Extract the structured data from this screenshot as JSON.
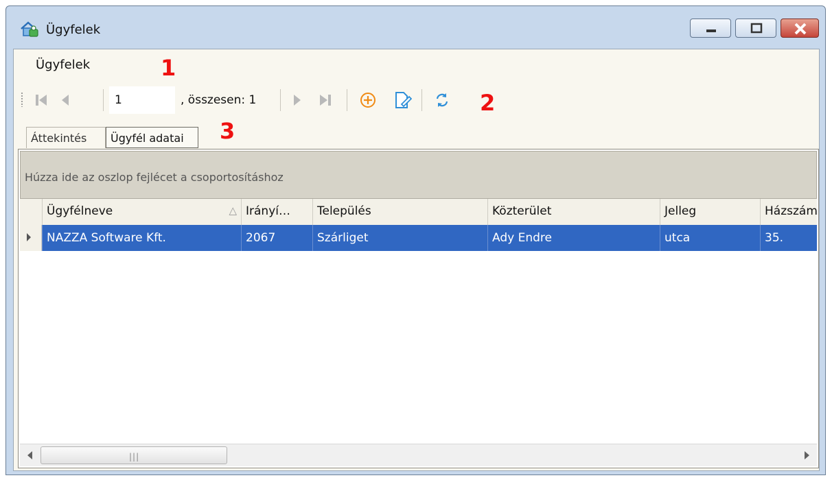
{
  "window": {
    "title": "Ügyfelek"
  },
  "menu": {
    "items": [
      "Ügyfelek"
    ]
  },
  "navigator": {
    "position": "1",
    "total_label": ", összesen: 1"
  },
  "annotations": [
    "1",
    "2",
    "3"
  ],
  "tabs": [
    "Áttekintés",
    "Ügyfél adatai"
  ],
  "grid": {
    "group_panel_text": "Húzza ide az oszlop fejlécet a csoportosításhoz",
    "columns": [
      "Ügyfélneve",
      "Irányí…",
      "Település",
      "Közterület",
      "Jelleg",
      "Házszám"
    ],
    "rows": [
      [
        "NAZZA Software Kft.",
        "2067",
        "Szárliget",
        "Ady Endre",
        "utca",
        "35."
      ]
    ],
    "sort_column": "Ügyfélneve",
    "sort_direction": "ascending"
  },
  "colors": {
    "selection": "#3067c2",
    "annotation": "#e11111",
    "accent_add": "#f08a14",
    "accent_edit": "#2f8fd8"
  },
  "icons": {
    "app": "customers-house-icon",
    "toolbar": [
      "first-record-icon",
      "previous-record-icon",
      "next-record-icon",
      "last-record-icon",
      "add-icon",
      "edit-icon",
      "refresh-icon"
    ]
  }
}
